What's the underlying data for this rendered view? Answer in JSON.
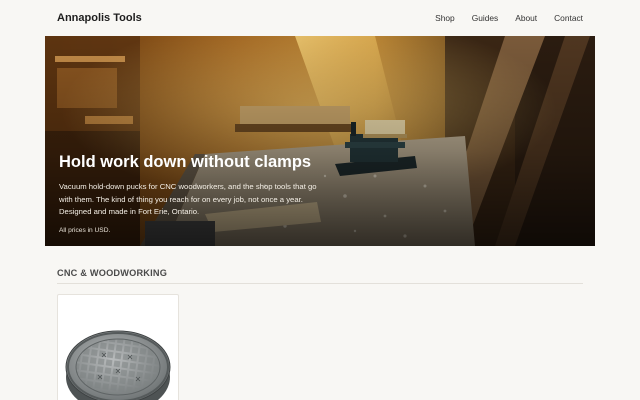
{
  "header": {
    "brand": "Annapolis Tools",
    "nav": [
      "Shop",
      "Guides",
      "About",
      "Contact"
    ]
  },
  "hero": {
    "title": "Hold work down without clamps",
    "description": "Vacuum hold-down pucks for CNC woodworkers, and the shop tools that go with them. The kind of thing you reach for on every job, not once a year. Designed and made in Fort Erie, Ontario.",
    "note": "All prices in USD."
  },
  "section": {
    "title": "CNC & WOODWORKING"
  },
  "products": [
    {
      "image": "vacuum-puck-image"
    }
  ],
  "colors": {
    "background": "#f8f7f4",
    "hero_overlay": "#2a1b0e",
    "heading": "#4a4a4a"
  }
}
